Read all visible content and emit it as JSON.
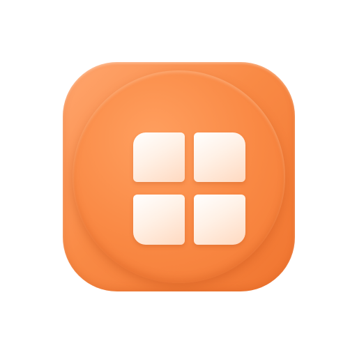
{
  "icon": {
    "name": "windows-grid-app-icon",
    "symbol": "four-tile-grid-icon",
    "colors": {
      "background_light": "#ffa66e",
      "background_mid": "#f98a45",
      "background_dark": "#f07530",
      "tile_light": "#ffffff",
      "tile_tint": "#ffd9c0"
    }
  }
}
